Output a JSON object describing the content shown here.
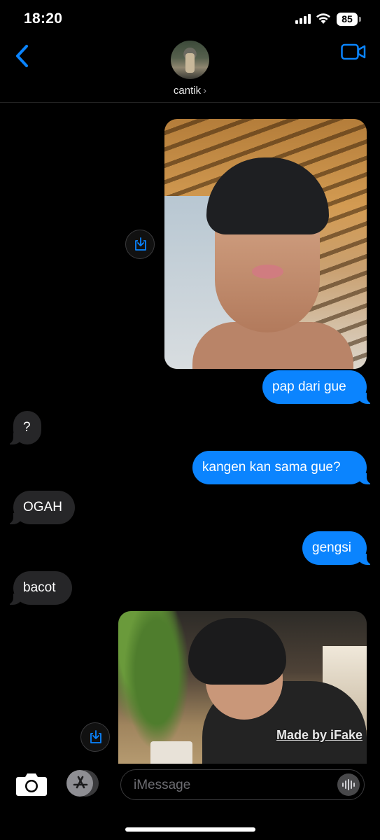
{
  "status_bar": {
    "time": "18:20",
    "battery": "85"
  },
  "header": {
    "contact_name": "cantik",
    "chevron": "›"
  },
  "messages": [
    {
      "type": "image",
      "direction": "outgoing"
    },
    {
      "type": "text",
      "direction": "outgoing",
      "text": "pap dari gue"
    },
    {
      "type": "text",
      "direction": "incoming",
      "text": "?"
    },
    {
      "type": "text",
      "direction": "outgoing",
      "text": "kangen kan sama gue?"
    },
    {
      "type": "text",
      "direction": "incoming",
      "text": "OGAH"
    },
    {
      "type": "text",
      "direction": "outgoing",
      "text": "gengsi"
    },
    {
      "type": "text",
      "direction": "incoming",
      "text": "bacot"
    },
    {
      "type": "image",
      "direction": "outgoing",
      "watermark": "Made by iFake"
    }
  ],
  "composer": {
    "placeholder": "iMessage"
  },
  "colors": {
    "outgoing_bubble": "#0b84fe",
    "incoming_bubble": "#262628",
    "accent": "#0a84ff",
    "background": "#000000"
  },
  "icons": [
    "back-chevron-icon",
    "video-call-icon",
    "download-icon",
    "camera-icon",
    "app-store-icon",
    "voice-waveform-icon",
    "signal-icon",
    "wifi-icon",
    "battery-icon"
  ]
}
